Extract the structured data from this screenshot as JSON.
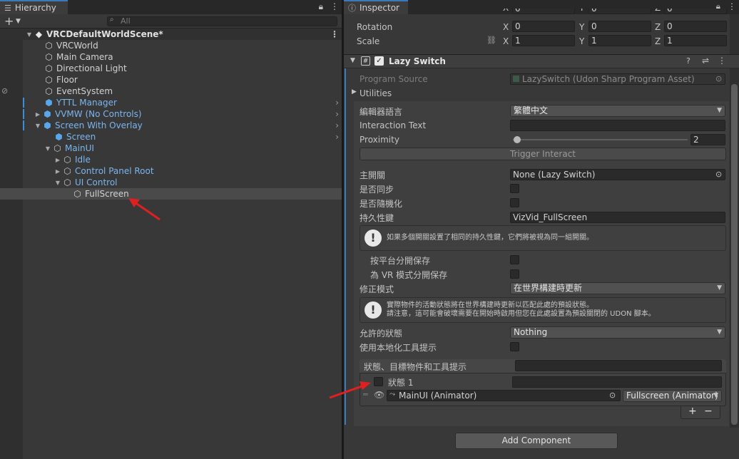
{
  "hierarchy": {
    "tab_label": "Hierarchy",
    "search_placeholder": "All",
    "scene_name": "VRCDefaultWorldScene*",
    "items": [
      {
        "label": "VRCWorld"
      },
      {
        "label": "Main Camera"
      },
      {
        "label": "Directional Light"
      },
      {
        "label": "Floor"
      },
      {
        "label": "EventSystem"
      },
      {
        "label": "YTTL Manager"
      },
      {
        "label": "VVMW (No Controls)"
      },
      {
        "label": "Screen With Overlay"
      },
      {
        "label": "Screen"
      },
      {
        "label": "MainUI"
      },
      {
        "label": "Idle"
      },
      {
        "label": "Control Panel Root"
      },
      {
        "label": "UI Control"
      },
      {
        "label": "FullScreen"
      }
    ]
  },
  "inspector": {
    "tab_label": "Inspector",
    "transform": {
      "rotation_label": "Rotation",
      "scale_label": "Scale",
      "axis_x": "X",
      "axis_y": "Y",
      "axis_z": "Z",
      "pos_x": "0",
      "pos_y": "0",
      "pos_z": "0",
      "rot_x": "0",
      "rot_y": "0",
      "rot_z": "0",
      "scale_x": "1",
      "scale_y": "1",
      "scale_z": "1"
    },
    "component": {
      "title": "Lazy Switch",
      "program_source_label": "Program Source",
      "program_source_value": "LazySwitch (Udon Sharp Program Asset)",
      "utilities_label": "Utilities",
      "editor_language_label": "編輯器語言",
      "editor_language_value": "繁體中文",
      "interaction_text_label": "Interaction Text",
      "interaction_text_value": "",
      "proximity_label": "Proximity",
      "proximity_value": "2",
      "trigger_button": "Trigger Interact",
      "master_switch_label": "主開關",
      "master_switch_value": "None (Lazy Switch)",
      "sync_label": "是否同步",
      "random_label": "是否隨機化",
      "persistence_key_label": "持久性鍵",
      "persistence_key_value": "VizVid_FullScreen",
      "help1": "如果多個開關設置了相同的持久性鍵，它們將被視為同一組開關。",
      "per_platform_label": "按平台分開保存",
      "per_vr_label": "為 VR 模式分開保存",
      "fix_mode_label": "修正模式",
      "fix_mode_value": "在世界構建時更新",
      "help2_line1": "實際物件的活動狀態將在世界構建時更新以匹配此處的預設狀態。",
      "help2_line2": "請注意，這可能會破壞需要在開始時啟用但您在此處設置為預設關閉的 UDON 腳本。",
      "allowed_states_label": "允許的狀態",
      "allowed_states_value": "Nothing",
      "localized_tooltip_label": "使用本地化工具提示",
      "states_list_header": "狀態、目標物件和工具提示",
      "state1_label": "狀態 1",
      "target_object_value": "MainUI (Animator)",
      "target_state_value": "Fullscreen (Animator)",
      "add_label": "+",
      "remove_label": "−"
    },
    "add_component_button": "Add Component"
  },
  "colors": {
    "accent_blue": "#3a79bb",
    "prefab_blue": "#7bb5ee",
    "annotation_red": "#e02020"
  }
}
